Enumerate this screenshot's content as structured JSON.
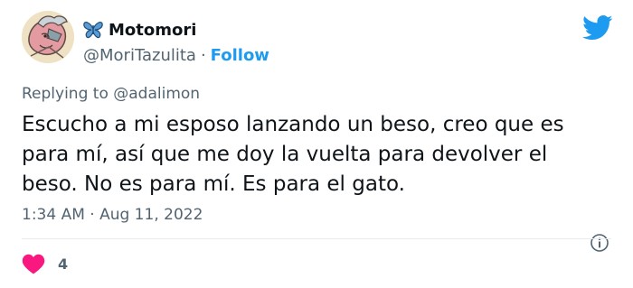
{
  "author": {
    "display_name": "Motomori",
    "handle": "@MoriTazulita",
    "separator": "·",
    "follow_label": "Follow"
  },
  "reply": {
    "prefix": "Replying to ",
    "to": "@adalimon"
  },
  "tweet": {
    "text": "Escucho a mi esposo lanzando un beso, creo que es para mí, así que me doy la vuelta para devolver el beso. No es para mí. Es para el gato.",
    "timestamp": "1:34 AM · Aug 11, 2022"
  },
  "engagement": {
    "likes": "4"
  },
  "colors": {
    "accent": "#1d9bf0",
    "heart": "#f91880",
    "secondary_text": "#536471"
  },
  "icons": {
    "brand": "twitter-bird-icon",
    "name_emoji": "butterfly-icon",
    "info": "info-icon",
    "like": "heart-icon"
  }
}
